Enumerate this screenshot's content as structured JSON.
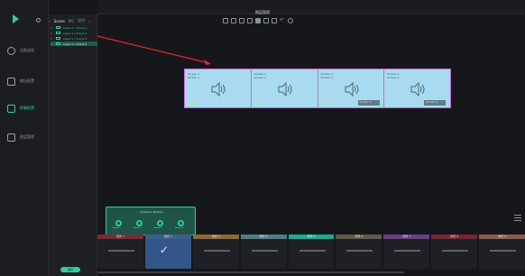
{
  "app": {
    "title": "图层管理"
  },
  "sidebar": {
    "items": [
      {
        "label": "设备连接",
        "icon": "search-icon"
      },
      {
        "label": "输出配置",
        "icon": "monitor-icon"
      },
      {
        "label": "屏幕配置",
        "icon": "edit-icon"
      },
      {
        "label": "图层管理",
        "icon": "grid-icon"
      }
    ],
    "active_index": 2
  },
  "layer_panel": {
    "tabs": [
      "Scene",
      "IPC",
      "信号"
    ],
    "active_tab": 0,
    "layers": [
      {
        "num": "1",
        "label": "Layer-1 / Scene-1"
      },
      {
        "num": "2",
        "label": "Layer-1 / Scene-2"
      },
      {
        "num": "3",
        "label": "Layer-1 / Scene-3"
      },
      {
        "num": "4",
        "label": "Layer-1 / Scene-4"
      }
    ],
    "selected_index": 3
  },
  "screens": [
    {
      "name": "Screen 1",
      "id": "Screen 1",
      "tag": "Screen 1",
      "box": ""
    },
    {
      "name": "Screen 2",
      "id": "Screen 2",
      "tag": "Screen 2",
      "box": ""
    },
    {
      "name": "Screen 3",
      "id": "Screen 3",
      "tag": "Screen 3",
      "box": "Screen 3"
    },
    {
      "name": "Screen 4",
      "id": "Screen 4",
      "tag": "",
      "box": "Screen 4"
    }
  ],
  "output_popup": {
    "title": "Output 1 Module",
    "knobs": [
      {
        "top": "Screen 1",
        "bottom": "Screen 1"
      },
      {
        "top": "Screen 2",
        "bottom": "Screen 2"
      },
      {
        "top": "Screen 3",
        "bottom": "Screen 3"
      },
      {
        "top": "Screen 4",
        "bottom": "Screen 4"
      }
    ]
  },
  "presets": [
    {
      "label": "场景 1",
      "color": "#7a2b38"
    },
    {
      "label": "场景 2",
      "color": "#3b5f8a"
    },
    {
      "label": "场景 3",
      "color": "#8b6a35"
    },
    {
      "label": "场景 4",
      "color": "#4f7d86"
    },
    {
      "label": "场景 5",
      "color": "#1fa79a"
    },
    {
      "label": "场景 6",
      "color": "#5f5a45"
    },
    {
      "label": "场景 7",
      "color": "#6a3e82"
    },
    {
      "label": "场景 8",
      "color": "#7a2530"
    },
    {
      "label": "场景 9",
      "color": "#8a5a50"
    }
  ],
  "selected_preset": 1,
  "save_label": "保存",
  "colors": {
    "accent": "#2ad0a0",
    "screen_fill": "#a8dbef",
    "screen_border": "#c86bd8",
    "arrow": "#e0282f"
  }
}
